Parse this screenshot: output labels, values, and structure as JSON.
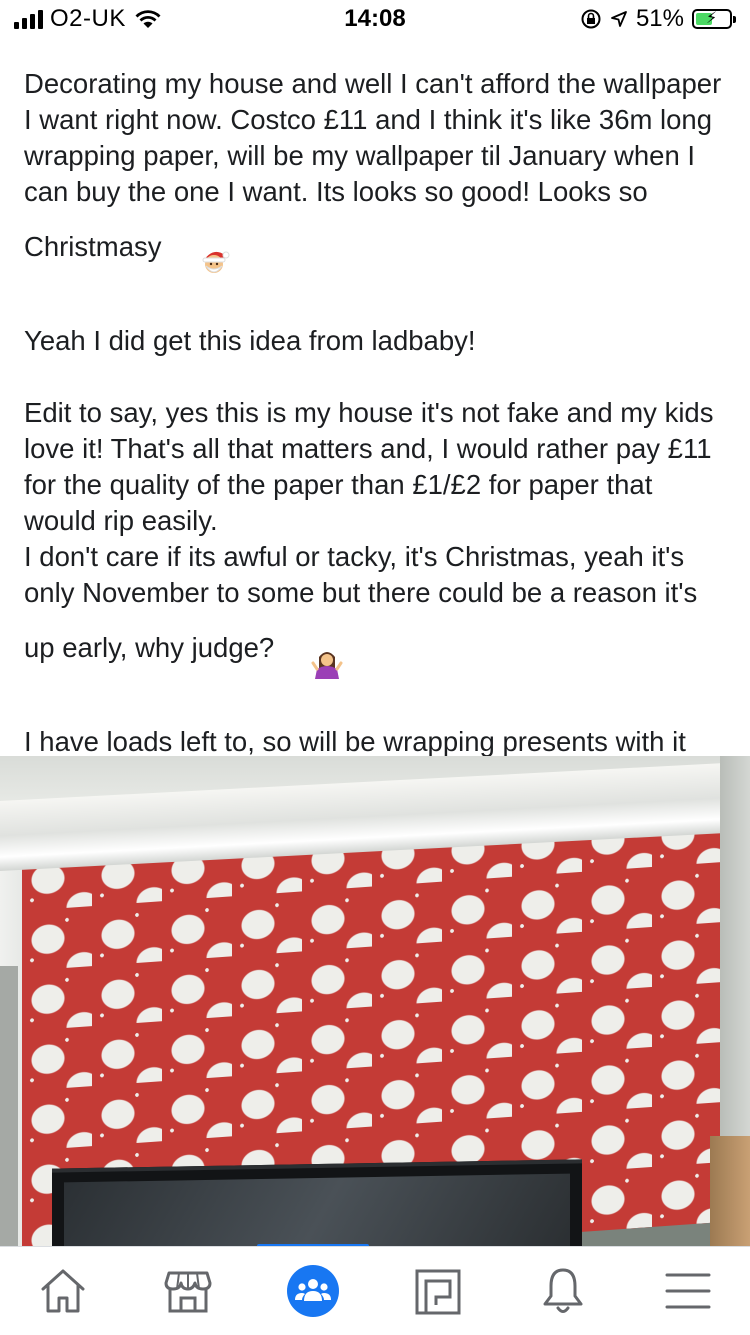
{
  "status_bar": {
    "carrier": "O2-UK",
    "time": "14:08",
    "battery": "51%",
    "battery_level": 0.51,
    "icons": [
      "signal-icon",
      "wifi-icon",
      "orientation-lock-icon",
      "location-icon",
      "battery-charging-icon"
    ]
  },
  "post": {
    "paragraphs": [
      "Decorating my house and well I can't afford the wallpaper I want right now. Costco £11 and I think it's like 36m long wrapping paper, will be my wallpaper til January when I can buy the one I want. Its looks so good! Looks so Christmasy",
      "Yeah I did get this idea from ladbaby!",
      "Edit to say, yes this is my house it's not fake and my kids love it! That's all that matters and, I would rather pay £11 for the quality of the paper than £1/£2 for paper that would rip easily.",
      "I don't care if its awful or tacky, it's Christmas, yeah it's only November to some but there could be a reason it's up early, why judge?",
      "I have loads left to, so will be wrapping presents with it to!"
    ],
    "emojis": [
      "santa-emoji",
      "shrug-emoji"
    ]
  },
  "tab_bar": {
    "active": "groups",
    "tabs": [
      {
        "id": "home",
        "icon": "home-icon"
      },
      {
        "id": "marketplace",
        "icon": "marketplace-icon"
      },
      {
        "id": "groups",
        "icon": "groups-icon"
      },
      {
        "id": "pages",
        "icon": "pages-icon"
      },
      {
        "id": "notifications",
        "icon": "bell-icon"
      },
      {
        "id": "menu",
        "icon": "menu-icon"
      }
    ]
  },
  "colors": {
    "accent": "#1877f2",
    "text": "#1c1e21",
    "icon": "#65676b",
    "wallpaper_red": "#c43b36"
  }
}
